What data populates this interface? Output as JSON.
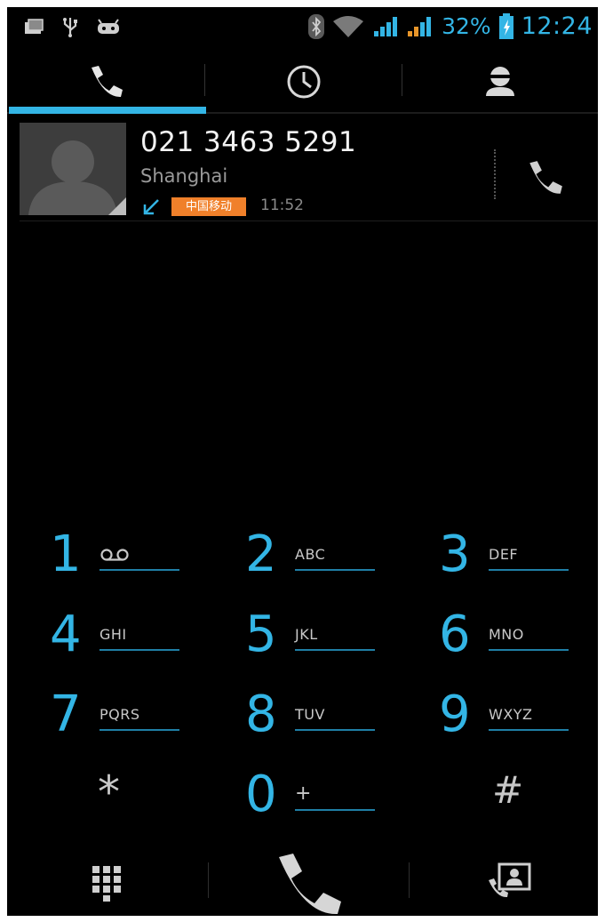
{
  "status_bar": {
    "icons": [
      "photo-icon",
      "usb-icon",
      "android-debug-icon",
      "bluetooth-icon",
      "wifi-icon",
      "signal-icon",
      "signal-icon-2",
      "battery-icon"
    ],
    "battery_percent": "32%",
    "clock": "12:24"
  },
  "tabs": [
    {
      "name": "phone",
      "icon": "phone-icon",
      "selected": true
    },
    {
      "name": "call-log",
      "icon": "clock-icon",
      "selected": false
    },
    {
      "name": "contacts",
      "icon": "contact-icon",
      "selected": false
    }
  ],
  "recent_call": {
    "number": "021 3463 5291",
    "location": "Shanghai",
    "carrier": "中国移动",
    "time": "11:52",
    "direction_icon": "incoming-call-icon"
  },
  "dialpad": {
    "keys": [
      {
        "digit": "1",
        "letters": "",
        "icon": "voicemail-icon"
      },
      {
        "digit": "2",
        "letters": "ABC"
      },
      {
        "digit": "3",
        "letters": "DEF"
      },
      {
        "digit": "4",
        "letters": "GHI"
      },
      {
        "digit": "5",
        "letters": "JKL"
      },
      {
        "digit": "6",
        "letters": "MNO"
      },
      {
        "digit": "7",
        "letters": "PQRS"
      },
      {
        "digit": "8",
        "letters": "TUV"
      },
      {
        "digit": "9",
        "letters": "WXYZ"
      },
      {
        "digit": "*",
        "letters": ""
      },
      {
        "digit": "0",
        "letters": "+"
      },
      {
        "digit": "#",
        "letters": ""
      }
    ]
  },
  "bottom_bar": {
    "icons": [
      "dialpad-toggle-icon",
      "call-icon",
      "add-contact-icon"
    ]
  },
  "colors": {
    "accent": "#33b5e5",
    "carrier_badge": "#f0802a",
    "background": "#000000"
  }
}
